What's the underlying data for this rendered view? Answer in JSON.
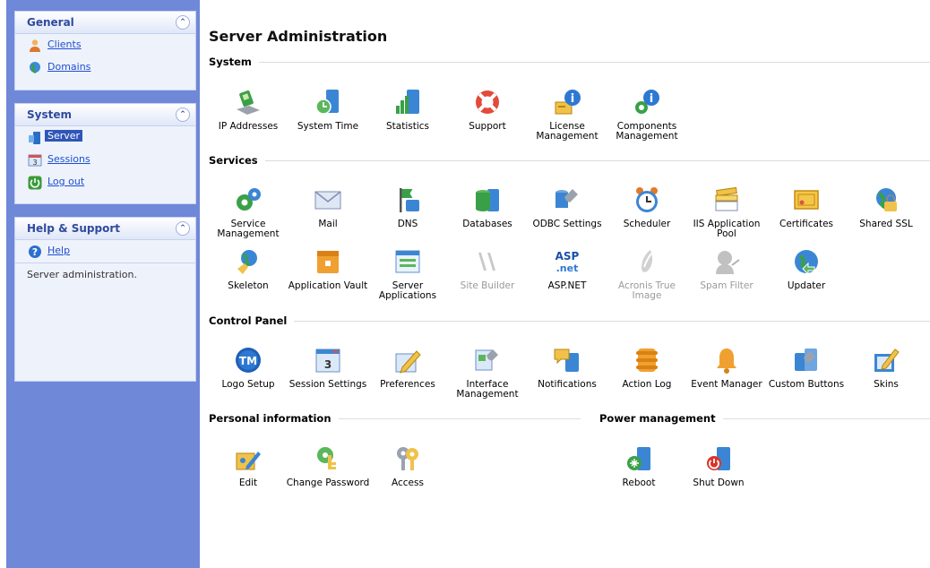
{
  "nav": {
    "general": {
      "title": "General",
      "items": [
        {
          "label": "Clients"
        },
        {
          "label": "Domains"
        }
      ]
    },
    "system": {
      "title": "System",
      "items": [
        {
          "label": "Server"
        },
        {
          "label": "Sessions"
        },
        {
          "label": "Log out"
        }
      ]
    },
    "help": {
      "title": "Help & Support",
      "items": [
        {
          "label": "Help"
        }
      ],
      "description": "Server administration."
    }
  },
  "main": {
    "title": "Server Administration",
    "sections": {
      "system": {
        "title": "System",
        "tools": [
          {
            "label": "IP Addresses",
            "icon": "ip-addresses-icon"
          },
          {
            "label": "System Time",
            "icon": "system-time-icon"
          },
          {
            "label": "Statistics",
            "icon": "statistics-icon"
          },
          {
            "label": "Support",
            "icon": "lifebuoy-icon"
          },
          {
            "label": "License Management",
            "icon": "license-icon"
          },
          {
            "label": "Components Management",
            "icon": "components-icon"
          }
        ]
      },
      "services": {
        "title": "Services",
        "tools": [
          {
            "label": "Service Management",
            "icon": "gears-icon"
          },
          {
            "label": "Mail",
            "icon": "envelope-icon"
          },
          {
            "label": "DNS",
            "icon": "dns-flag-icon"
          },
          {
            "label": "Databases",
            "icon": "database-icon"
          },
          {
            "label": "ODBC Settings",
            "icon": "odbc-icon"
          },
          {
            "label": "Scheduler",
            "icon": "alarm-clock-icon"
          },
          {
            "label": "IIS Application Pool",
            "icon": "iis-pool-icon"
          },
          {
            "label": "Certificates",
            "icon": "certificate-icon"
          },
          {
            "label": "Shared SSL",
            "icon": "shared-ssl-icon"
          },
          {
            "label": "Skeleton",
            "icon": "skeleton-icon"
          },
          {
            "label": "Application Vault",
            "icon": "application-vault-icon"
          },
          {
            "label": "Server Applications",
            "icon": "server-applications-icon"
          },
          {
            "label": "Site Builder",
            "icon": "site-builder-icon"
          },
          {
            "label": "ASP.NET",
            "icon": "aspnet-icon"
          },
          {
            "label": "Acronis True Image",
            "icon": "acronis-icon"
          },
          {
            "label": "Spam Filter",
            "icon": "spam-filter-icon"
          },
          {
            "label": "Updater",
            "icon": "updater-icon"
          }
        ]
      },
      "control_panel": {
        "title": "Control Panel",
        "tools": [
          {
            "label": "Logo Setup",
            "icon": "logo-tm-icon"
          },
          {
            "label": "Session Settings",
            "icon": "session-settings-icon"
          },
          {
            "label": "Preferences",
            "icon": "preferences-icon"
          },
          {
            "label": "Interface Management",
            "icon": "interface-icon"
          },
          {
            "label": "Notifications",
            "icon": "notifications-icon"
          },
          {
            "label": "Action Log",
            "icon": "action-log-icon"
          },
          {
            "label": "Event Manager",
            "icon": "event-bell-icon"
          },
          {
            "label": "Custom Buttons",
            "icon": "custom-buttons-icon"
          },
          {
            "label": "Skins",
            "icon": "skins-icon"
          }
        ]
      },
      "personal": {
        "title": "Personal information",
        "tools": [
          {
            "label": "Edit",
            "icon": "edit-icon"
          },
          {
            "label": "Change Password",
            "icon": "change-password-icon"
          },
          {
            "label": "Access",
            "icon": "access-keys-icon"
          }
        ]
      },
      "power": {
        "title": "Power management",
        "tools": [
          {
            "label": "Reboot",
            "icon": "reboot-icon"
          },
          {
            "label": "Shut Down",
            "icon": "shutdown-icon"
          }
        ]
      }
    }
  }
}
